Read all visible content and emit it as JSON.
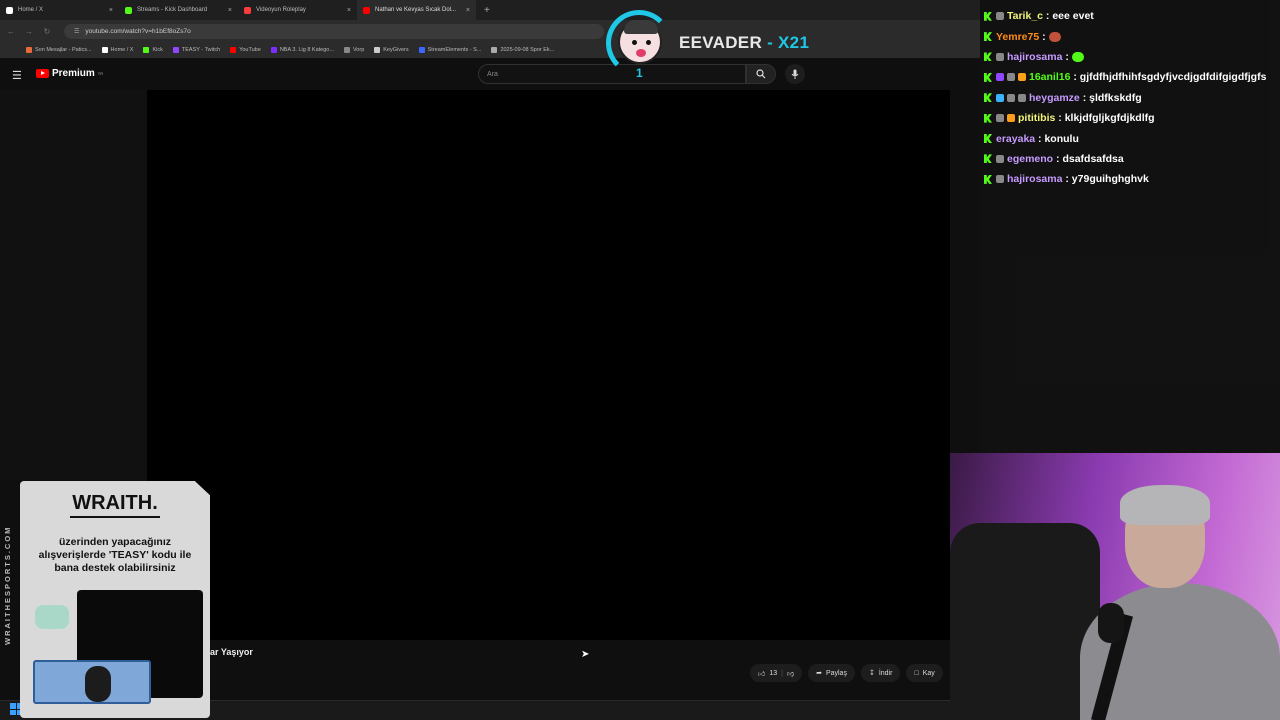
{
  "browser": {
    "tabs": [
      {
        "label": "Home / X",
        "color": "#ffffff"
      },
      {
        "label": "Streams - Kick Dashboard",
        "color": "#53fc18"
      },
      {
        "label": "Videoyun Roleplay",
        "color": "#ff3b3b"
      },
      {
        "label": "Nathan ve Kevyas Sıcak Dol...",
        "color": "#ff0000"
      }
    ],
    "new_tab": "+",
    "url": "youtube.com/watch?v=h1bEf8oZs7o",
    "bookmarks": [
      {
        "label": "Son Mesajlar - Patics...",
        "color": "#e86a3a"
      },
      {
        "label": "Home / X",
        "color": "#ffffff"
      },
      {
        "label": "Kick",
        "color": "#53fc18"
      },
      {
        "label": "TEASY - Twitch",
        "color": "#9146ff"
      },
      {
        "label": "YouTube",
        "color": "#ff0000"
      },
      {
        "label": "NBA 3. Lig 8 Katego...",
        "color": "#7b2cff"
      },
      {
        "label": "Vorp",
        "color": "#888888"
      },
      {
        "label": "KeyGivers",
        "color": "#cccccc"
      },
      {
        "label": "StreamElements - S...",
        "color": "#3d66ff"
      },
      {
        "label": "2025-09-08 Spor Ek...",
        "color": "#aaaaaa"
      }
    ]
  },
  "youtube": {
    "logo_text": "Premium",
    "logo_sup": "TR",
    "search_placeholder": "Ara",
    "video_title_fragment": "ar Yaşıyor",
    "like_count": "13",
    "share_label": "Paylaş",
    "download_label": "İndir",
    "save_label": "Kay"
  },
  "overlay": {
    "streamer_name": "EEVADER",
    "suffix": "- X21",
    "counter": "1"
  },
  "chat": [
    {
      "user": "Tarik_c",
      "color": "#f4f47a",
      "text": "eee evet",
      "badges": [
        "#888888"
      ]
    },
    {
      "user": "Yemre75",
      "color": "#ff8c1a",
      "text": "",
      "badges": [],
      "emote": "#c0513b"
    },
    {
      "user": "hajirosama",
      "color": "#c79bff",
      "text": "",
      "badges": [
        "#888888"
      ],
      "emote": "#53fc18"
    },
    {
      "user": "16anil16",
      "color": "#53fc18",
      "text": "gjfdfhjdfhihfsgdyfjvcdjgdfdifgigdfjgfs",
      "badges": [
        "#9146ff",
        "#888888",
        "#ff9e1a"
      ]
    },
    {
      "user": "heygamze",
      "color": "#c79bff",
      "text": "şldfkskdfg",
      "badges": [
        "#3ab4ff",
        "#888888",
        "#888888"
      ]
    },
    {
      "user": "pititibis",
      "color": "#f4f47a",
      "text": "klkjdfgljkgfdjkdlfg",
      "badges": [
        "#888888",
        "#ff9e1a"
      ]
    },
    {
      "user": "erayaka",
      "color": "#c79bff",
      "text": "konulu",
      "badges": []
    },
    {
      "user": "egemeno",
      "color": "#c79bff",
      "text": "dsafdsafdsa",
      "badges": [
        "#888888"
      ]
    },
    {
      "user": "hajirosama",
      "color": "#c79bff",
      "text": "y79guihghghvk",
      "badges": [
        "#888888"
      ]
    }
  ],
  "sponsor": {
    "brand": "WRAITH.",
    "text": "üzerinden yapacağınız alışverişlerde 'TEASY' kodu ile bana destek olabilirsiniz",
    "side_text": "WRAITHESPORTS.COM"
  }
}
